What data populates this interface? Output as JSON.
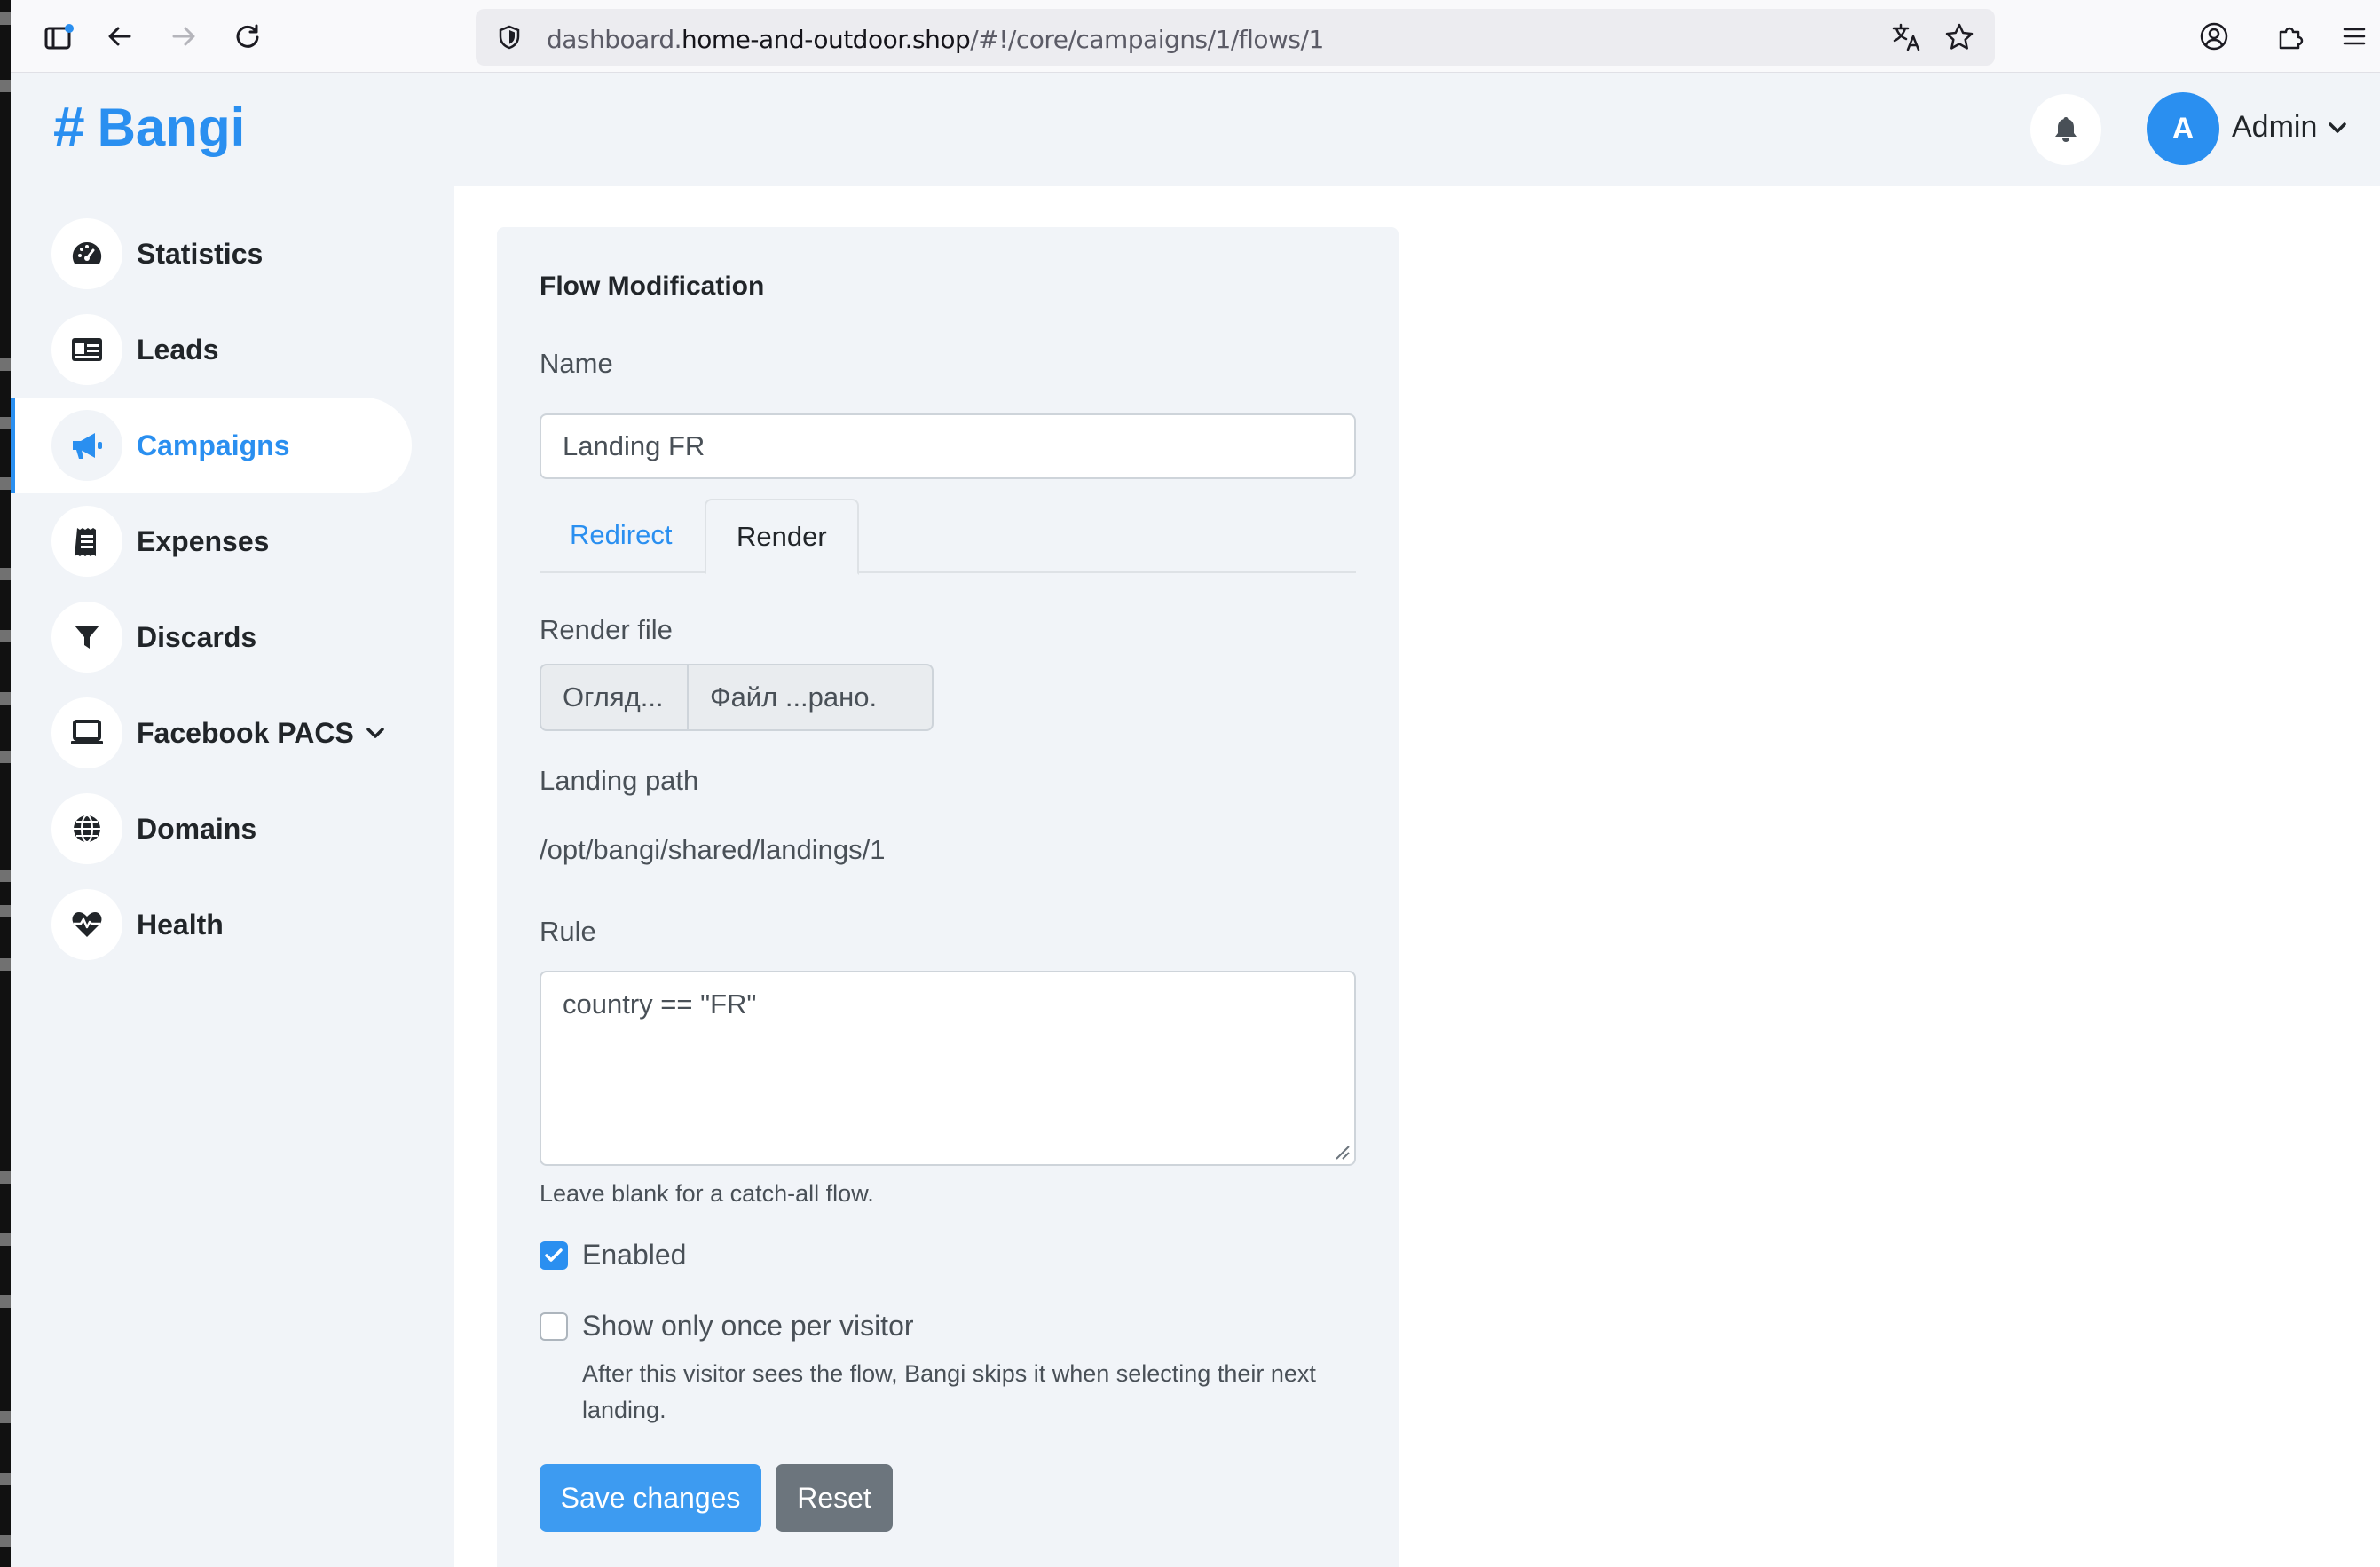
{
  "browser": {
    "url_prefix": "dashboard.",
    "url_host": "home-and-outdoor.shop",
    "url_path": "/#!/core/campaigns/1/flows/1"
  },
  "app": {
    "brand": "Bangi",
    "brand_symbol": "#",
    "user_initial": "A",
    "user_name": "Admin",
    "accent_color": "#2a8ff0"
  },
  "sidebar": {
    "items": [
      {
        "label": "Statistics",
        "icon": "gauge-icon"
      },
      {
        "label": "Leads",
        "icon": "id-card-icon"
      },
      {
        "label": "Campaigns",
        "icon": "megaphone-icon",
        "active": true
      },
      {
        "label": "Expenses",
        "icon": "receipt-icon"
      },
      {
        "label": "Discards",
        "icon": "filter-icon"
      },
      {
        "label": "Facebook PACS",
        "icon": "laptop-icon",
        "expandable": true
      },
      {
        "label": "Domains",
        "icon": "globe-icon"
      },
      {
        "label": "Health",
        "icon": "heartbeat-icon"
      }
    ]
  },
  "form": {
    "title": "Flow Modification",
    "name_label": "Name",
    "name_value": "Landing FR",
    "tabs": [
      {
        "label": "Redirect",
        "active": false
      },
      {
        "label": "Render",
        "active": true
      }
    ],
    "render_file_label": "Render file",
    "browse_label": "Огляд...",
    "file_status": "Файл ...рано.",
    "landing_path_label": "Landing path",
    "landing_path_value": "/opt/bangi/shared/landings/1",
    "rule_label": "Rule",
    "rule_value": "country == \"FR\"",
    "rule_help": "Leave blank for a catch-all flow.",
    "enabled_label": "Enabled",
    "enabled_checked": true,
    "once_label": "Show only once per visitor",
    "once_checked": false,
    "once_help": "After this visitor sees the flow, Bangi skips it when selecting their next landing.",
    "save_label": "Save changes",
    "reset_label": "Reset"
  }
}
